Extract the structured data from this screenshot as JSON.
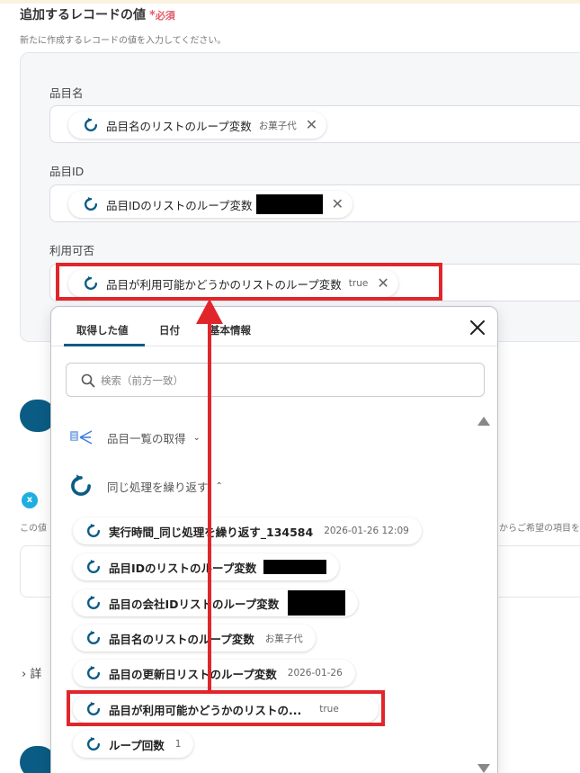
{
  "section": {
    "title": "追加するレコードの値",
    "required_mark": "*",
    "required_label": "必須",
    "description": "新たに作成するレコードの値を入力してください。"
  },
  "fields": [
    {
      "label": "品目名",
      "chip_label": "品目名のリストのループ変数",
      "chip_value": "お菓子代"
    },
    {
      "label": "品目ID",
      "chip_label": "品目IDのリストのループ変数",
      "chip_value": ""
    },
    {
      "label": "利用可否",
      "chip_label": "品目が利用可能かどうかのリストのループ変数",
      "chip_value": "true"
    }
  ],
  "background": {
    "text_left": "この値",
    "text_right": "からご希望の項目を",
    "detail_label": "詳"
  },
  "popup": {
    "tabs": [
      {
        "label": "取得した値",
        "active": true
      },
      {
        "label": "日付",
        "active": false
      },
      {
        "label": "基本情報",
        "active": false
      }
    ],
    "search_placeholder": "検索（前方一致）",
    "groups": [
      {
        "label": "品目一覧の取得",
        "chevron": "down"
      },
      {
        "label": "同じ処理を繰り返す",
        "chevron": "up"
      }
    ],
    "items": [
      {
        "label": "実行時間_同じ処理を繰り返す_134584",
        "value": "2026-01-26 12:09"
      },
      {
        "label": "品目IDのリストのループ変数",
        "value": ""
      },
      {
        "label": "品目の会社IDリストのループ変数",
        "value": ""
      },
      {
        "label": "品目名のリストのループ変数",
        "value": "お菓子代"
      },
      {
        "label": "品目の更新日リストのループ変数",
        "value": "2026-01-26"
      },
      {
        "label": "品目が利用可能かどうかのリストの...",
        "value": "true"
      },
      {
        "label": "ループ回数",
        "value": "1"
      }
    ]
  },
  "colors": {
    "accent": "#0b5c84",
    "highlight": "#e1262b",
    "required": "#e25c6b"
  }
}
